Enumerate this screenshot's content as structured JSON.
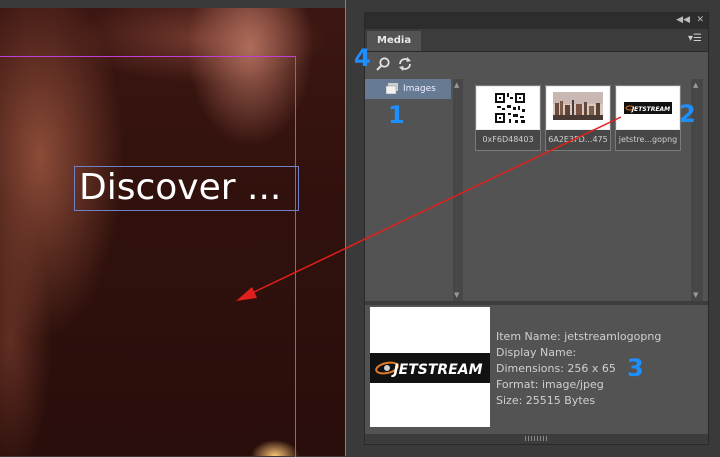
{
  "canvas": {
    "headline": "Discover ..."
  },
  "panel": {
    "tab": "Media",
    "folders": [
      {
        "label": "Images"
      }
    ],
    "thumbnails": [
      {
        "caption": "0xF6D48403",
        "kind": "qr-code"
      },
      {
        "caption": "6A2E3FD...475",
        "kind": "photo"
      },
      {
        "caption": "jetstre...gopng",
        "kind": "jetstream-logo"
      }
    ],
    "logo_text": "JETSTREAM",
    "details": {
      "item_name": "Item Name: jetstreamlogopng",
      "display_name": "Display Name:",
      "dimensions": "Dimensions: 256 x 65",
      "format": "Format: image/jpeg",
      "size": "Size: 25515 Bytes"
    }
  },
  "annotations": {
    "markers": [
      "1",
      "2",
      "3",
      "4"
    ],
    "arrow_color": "#e0201c",
    "marker_color": "#1e8fff"
  },
  "colors": {
    "panel_bg": "#535353",
    "selection": "#677a94",
    "guide": "#c03fd6"
  }
}
